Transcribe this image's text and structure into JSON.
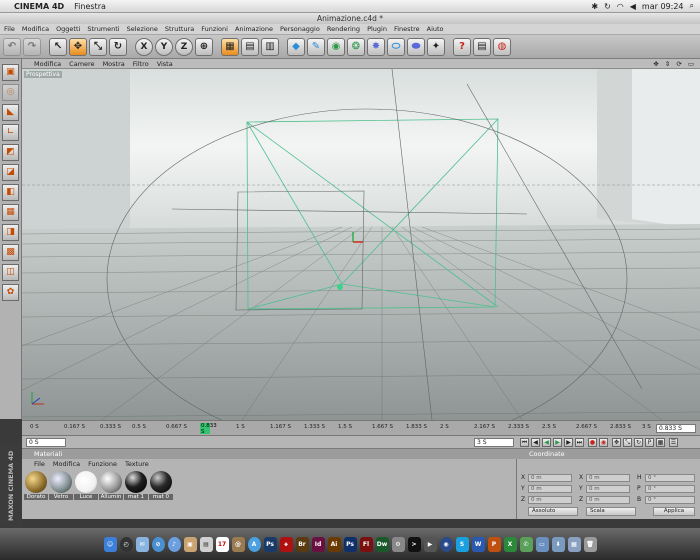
{
  "menubar": {
    "apple": "",
    "app_name": "CINEMA 4D",
    "menus": [
      "Finestra"
    ],
    "clock": "mar 09:24"
  },
  "window": {
    "title": "Animazione.c4d *"
  },
  "app_menu": [
    "File",
    "Modifica",
    "Oggetti",
    "Strumenti",
    "Selezione",
    "Struttura",
    "Funzioni",
    "Animazione",
    "Personaggio",
    "Rendering",
    "Plugin",
    "Finestre",
    "Aiuto"
  ],
  "toolbar": {
    "axis_x": "X",
    "axis_y": "Y",
    "axis_z": "Z"
  },
  "viewport": {
    "menu": [
      "Modifica",
      "Camere",
      "Mostra",
      "Filtro",
      "Vista"
    ],
    "label": "Prospettiva"
  },
  "timeline": {
    "ticks": [
      "0 S",
      "0.167 S",
      "0.333 S",
      "0.5 S",
      "0.667 S",
      "0.833 S",
      "1 S",
      "1.167 S",
      "1.333 S",
      "1.5 S",
      "1.667 S",
      "1.833 S",
      "2 S",
      "2.167 S",
      "2.333 S",
      "2.5 S",
      "2.667 S",
      "2.833 S",
      "3 S"
    ],
    "current": "0.833 S",
    "current_field": "0.833 S",
    "start_field": "0 S",
    "end_field": "3 S"
  },
  "materials": {
    "title": "Materiali",
    "menu": [
      "File",
      "Modifica",
      "Funzione",
      "Texture"
    ],
    "items": [
      {
        "label": "Dorato",
        "color": "#8a6a2a"
      },
      {
        "label": "Vetro",
        "color": "#7c8a8c"
      },
      {
        "label": "Luce",
        "color": "#f2f2f2"
      },
      {
        "label": "Allumin",
        "color": "#9a9a9a"
      },
      {
        "label": "mat 1",
        "color": "#1e1e1e"
      },
      {
        "label": "mat 0",
        "color": "#2a2a2a"
      }
    ]
  },
  "coords": {
    "title": "Coordinate",
    "rows": [
      {
        "a": "X",
        "a_val": "0 m",
        "b": "X",
        "b_val": "0 m",
        "c": "H",
        "c_val": "0 °"
      },
      {
        "a": "Y",
        "a_val": "0 m",
        "b": "Y",
        "b_val": "0 m",
        "c": "P",
        "c_val": "0 °"
      },
      {
        "a": "Z",
        "a_val": "0 m",
        "b": "Z",
        "b_val": "0 m",
        "c": "B",
        "c_val": "0 °"
      }
    ],
    "mode1": "Assoluto",
    "mode2": "Scala",
    "apply": "Applica"
  },
  "logo": {
    "text": "MAXON CINEMA 4D"
  },
  "dock": [
    "Finder",
    "Dashboard",
    "Mail",
    "Safari",
    "iTunes",
    "iPhoto",
    "Preview",
    "Calendar",
    "Contacts",
    "App Store",
    "Photoshop",
    "Acrobat",
    "Bridge",
    "InDesign",
    "Illustrator",
    "Photoshop CS",
    "Flash",
    "Dreamweaver",
    "Utility",
    "Terminal",
    "Movie",
    "Cinema 4D",
    "Skype",
    "Word",
    "PowerPoint",
    "Excel",
    "Chat",
    "Folder",
    "Downloads",
    "Apps",
    "Trash"
  ]
}
